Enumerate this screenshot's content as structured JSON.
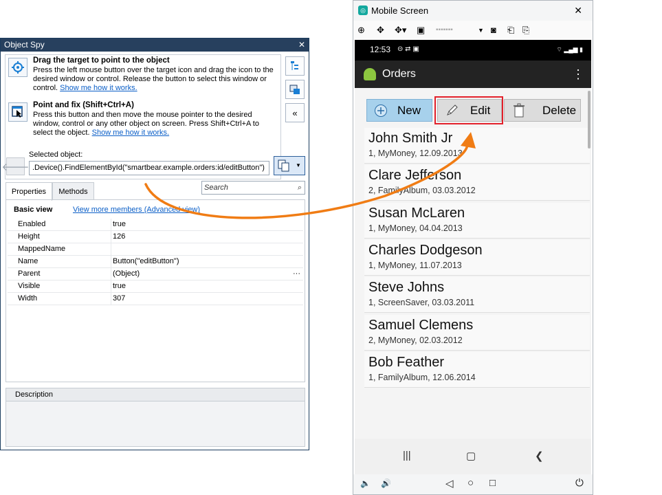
{
  "spy": {
    "title": "Object Spy",
    "close": "✕",
    "drag_title": "Drag the target to point to the object",
    "drag_text": "Press the left mouse button over the target icon and drag the icon to the desired window or control. Release the button to select this window or control.",
    "drag_link": "Show me how it works.",
    "fix_title": "Point and fix (Shift+Ctrl+A)",
    "fix_text": "Press this button and then move the mouse pointer to the desired window, control or any other object on screen. Press Shift+Ctrl+A to select the object.",
    "fix_link": "Show me how it works.",
    "collapse": "«",
    "selected_label": "Selected object:",
    "selected_value": ".Device().FindElementById(\"smartbear.example.orders:id/editButton\")",
    "tab_properties": "Properties",
    "tab_methods": "Methods",
    "search_placeholder": "Search",
    "basic_view": "Basic view",
    "view_more": "View more members (Advanced view)",
    "properties": [
      {
        "name": "Enabled",
        "value": "true"
      },
      {
        "name": "Height",
        "value": "126"
      },
      {
        "name": "MappedName",
        "value": ""
      },
      {
        "name": "Name",
        "value": "Button(\"editButton\")"
      },
      {
        "name": "Parent",
        "value": "(Object)"
      },
      {
        "name": "Visible",
        "value": "true"
      },
      {
        "name": "Width",
        "value": "307"
      }
    ],
    "ellipsis": "···",
    "description_header": "Description"
  },
  "mobile": {
    "title": "Mobile Screen",
    "close": "✕",
    "device_name": "▪▪▪▪▪▪▪",
    "status_time": "12:53",
    "app_title": "Orders",
    "btn_new": "New",
    "btn_edit": "Edit",
    "btn_delete": "Delete",
    "orders": [
      {
        "name": "John Smith Jr",
        "detail": "1, MyMoney, 12.09.2013"
      },
      {
        "name": "Clare Jefferson",
        "detail": "2, FamilyAlbum, 03.03.2012"
      },
      {
        "name": "Susan McLaren",
        "detail": "1, MyMoney, 04.04.2013"
      },
      {
        "name": "Charles Dodgeson",
        "detail": "1, MyMoney, 11.07.2013"
      },
      {
        "name": "Steve Johns",
        "detail": "1, ScreenSaver, 03.03.2011"
      },
      {
        "name": "Samuel Clemens",
        "detail": "2, MyMoney, 02.03.2012"
      },
      {
        "name": "Bob Feather",
        "detail": "1, FamilyAlbum, 12.06.2014"
      }
    ]
  },
  "colors": {
    "arrow": "#f07c14",
    "highlight": "#e2202a",
    "title_bar": "#27405e",
    "new_button": "#a7d1ec"
  }
}
